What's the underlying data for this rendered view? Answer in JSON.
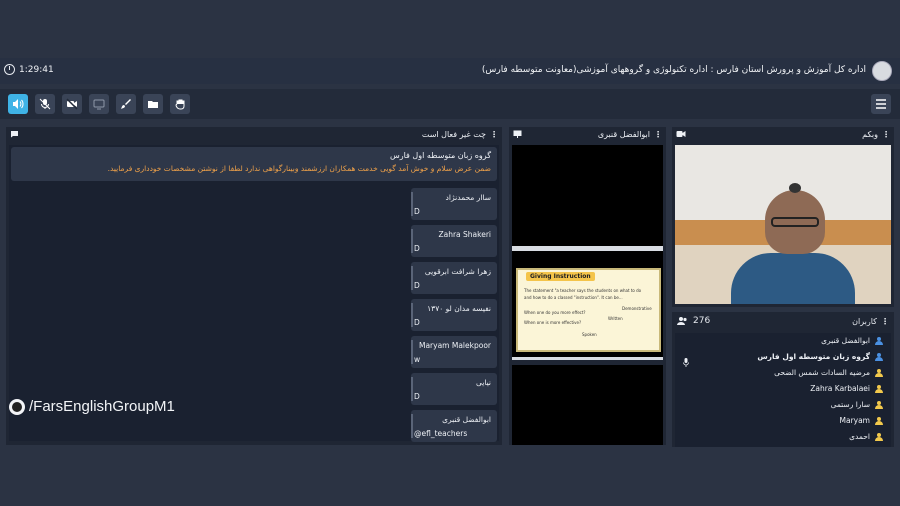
{
  "header": {
    "org_title": "اداره کل آموزش و پرورش استان فارس : اداره تکنولوژی و گروههای آموزشی(معاونت متوسطه فارس)",
    "elapsed_time": "1:29:41"
  },
  "toolbar": {
    "icons": [
      "speaker-icon",
      "mic-off-icon",
      "camera-off-icon",
      "screen-share-icon",
      "brush-icon",
      "folder-icon",
      "raise-hand-icon"
    ],
    "active_color": "#3fb3e6"
  },
  "chat": {
    "title": "چت غیر فعال است",
    "welcome_title": "گروه زبان متوسطه اول فارس",
    "welcome_message": "ضمن عرض سلام و خوش آمد گویی خدمت همکاران ارزشمند وبینارگواهی ندارد لطفا از نوشتن مشخصات خودداری فرمایید.",
    "welcome_color": "#f0a24a",
    "messages": [
      {
        "name": "ساار محمدنژاد",
        "text": "D"
      },
      {
        "name": "Zahra Shakeri",
        "text": "D"
      },
      {
        "name": "زهرا شرافت ابرقویی",
        "text": "D"
      },
      {
        "name": "نفیسه مدان لو ۱۳۷۰",
        "text": "D"
      },
      {
        "name": "Maryam Malekpoor",
        "text": "w"
      },
      {
        "name": "نیایی",
        "text": "D"
      },
      {
        "name": "ابوالفضل قنبری",
        "text": "@efl_teachers"
      }
    ]
  },
  "watermark": "/FarsEnglishGroupM1",
  "share": {
    "title": "ابوالفضل قنبری",
    "slide_title": "Giving Instruction",
    "slide_lines": [
      "The statement \"a teacher says the students on what to do",
      "and how to do a classed \"instruction\". It can be...",
      "When one do you more effect?",
      "When one is more effective?"
    ],
    "slide_words": [
      "Demonstrative",
      "Written",
      "Spoken"
    ]
  },
  "webcam": {
    "title": "وبکم"
  },
  "users": {
    "title": "کاربران",
    "count": "276",
    "list": [
      {
        "name": "ابوالفضل قنبری",
        "color": "#4a90e2"
      },
      {
        "name": "گروه زبان متوسطه اول فارس",
        "color": "#4a90e2"
      },
      {
        "name": "مرضیه السادات شمس الضحی",
        "color": "#f2c94c"
      },
      {
        "name": "Zahra Karbalaei",
        "color": "#f2c94c"
      },
      {
        "name": "سارا رستمی",
        "color": "#f2c94c"
      },
      {
        "name": "Maryam",
        "color": "#f2c94c"
      },
      {
        "name": "احمدی",
        "color": "#f2c94c"
      }
    ]
  }
}
